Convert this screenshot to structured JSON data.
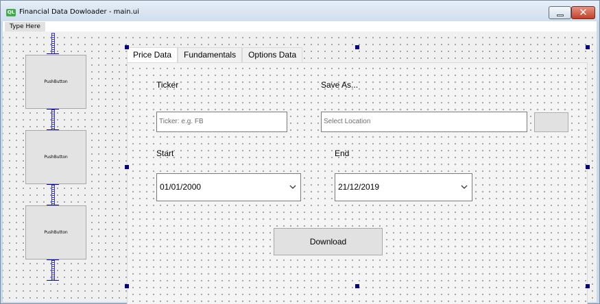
{
  "window": {
    "title": "Financial Data Dowloader - main.ui",
    "icon_text": "QL",
    "close_glyph": "✕"
  },
  "menubar": {
    "type_here": "Type Here"
  },
  "left_buttons": [
    "PushButton",
    "PushButton",
    "PushButton"
  ],
  "tabs": [
    {
      "label": "Price Data",
      "active": true
    },
    {
      "label": "Fundamentals",
      "active": false
    },
    {
      "label": "Options Data",
      "active": false
    }
  ],
  "price_data": {
    "ticker_label": "Ticker",
    "ticker_placeholder": "Ticker: e.g. FB",
    "save_label": "Save As...",
    "save_placeholder": "Select Location",
    "start_label": "Start",
    "start_value": "01/01/2000",
    "end_label": "End",
    "end_value": "21/12/2019",
    "download_label": "Download"
  },
  "colors": {
    "handle": "#000080",
    "spacer": "#2f2fff",
    "close_button": "#c2412a"
  }
}
